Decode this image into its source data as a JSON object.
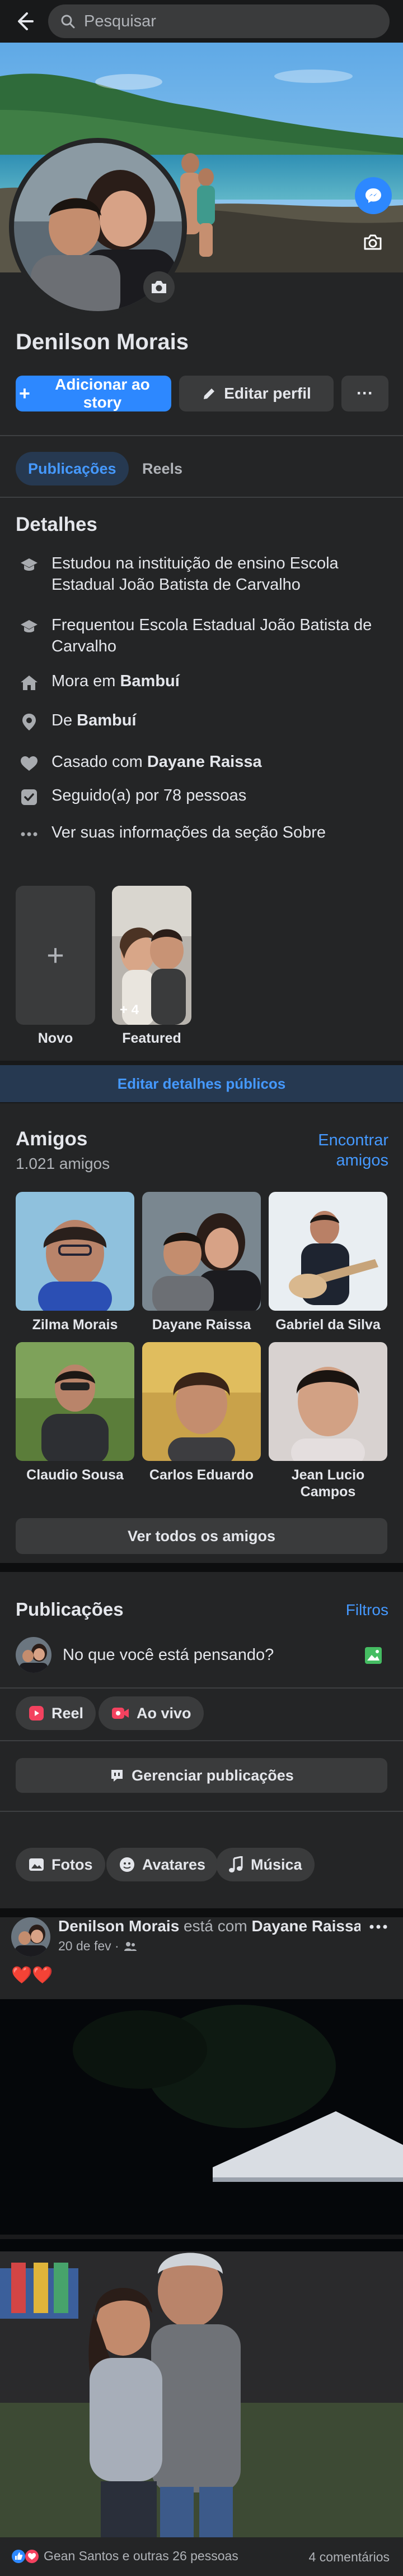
{
  "top_bar": {
    "search_placeholder": "Pesquisar"
  },
  "profile": {
    "name": "Denilson Morais",
    "add_story_label": "Adicionar ao story",
    "edit_profile_label": "Editar perfil",
    "more_label": "···"
  },
  "tabs": [
    {
      "label": "Publicações",
      "active": true
    },
    {
      "label": "Reels",
      "active": false
    }
  ],
  "details": {
    "title": "Detalhes",
    "items": [
      {
        "icon": "graduation-cap-icon",
        "text": "Estudou na instituição de ensino Escola Estadual João Batista de Carvalho"
      },
      {
        "icon": "graduation-cap-icon",
        "text": "Frequentou Escola Estadual João Batista de Carvalho"
      },
      {
        "icon": "home-icon",
        "prefix": "Mora em ",
        "bold": "Bambuí"
      },
      {
        "icon": "location-pin-icon",
        "prefix": "De ",
        "bold": "Bambuí"
      },
      {
        "icon": "heart-icon",
        "prefix": "Casado com ",
        "bold": "Dayane Raissa"
      },
      {
        "icon": "followers-icon",
        "text": "Seguido(a) por 78 pessoas"
      },
      {
        "icon": "more-dots-icon",
        "text": "Ver suas informações da seção Sobre"
      }
    ]
  },
  "highlights": {
    "new_label": "Novo",
    "featured_label": "Featured",
    "featured_count": "+ 4"
  },
  "edit_public_details_label": "Editar detalhes públicos",
  "friends": {
    "title": "Amigos",
    "count": "1.021 amigos",
    "find_label_line1": "Encontrar",
    "find_label_line2": "amigos",
    "list": [
      {
        "name": "Zilma Morais"
      },
      {
        "name": "Dayane Raissa"
      },
      {
        "name": "Gabriel da Silva"
      },
      {
        "name": "Claudio Sousa"
      },
      {
        "name": "Carlos Eduardo"
      },
      {
        "name": "Jean Lucio Campos"
      }
    ],
    "see_all_label": "Ver todos os amigos"
  },
  "posts_section": {
    "title": "Publicações",
    "filters_label": "Filtros",
    "composer_placeholder": "No que você está pensando?",
    "reel_label": "Reel",
    "live_label": "Ao vivo",
    "manage_label": "Gerenciar publicações",
    "chips": [
      {
        "label": "Fotos"
      },
      {
        "label": "Avatares"
      },
      {
        "label": "Música"
      }
    ]
  },
  "post": {
    "author": "Denilson Morais",
    "connector": " está com ",
    "tagged": "Dayane Raissa",
    "suffix": ".",
    "date": "20 de fev ·",
    "caption_emoji": "❤️❤️",
    "reactions_text": "Gean Santos e outras 26 pessoas",
    "comments_text": "4 comentários"
  },
  "colors": {
    "accent": "#2d88ff",
    "background": "#18191a",
    "card": "#242526",
    "button": "#3a3b3c"
  }
}
